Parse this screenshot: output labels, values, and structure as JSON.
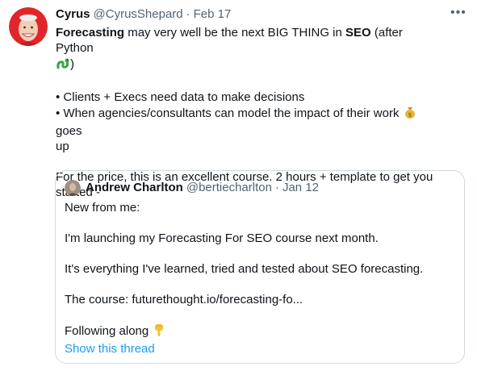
{
  "tweet": {
    "author_name": "Cyrus",
    "author_handle": "@CyrusShepard",
    "separator": "·",
    "date": "Feb 17",
    "more_label": "•••",
    "line1_bold1": "Forecasting",
    "line1_text1": " may very well be the next BIG THING in ",
    "line1_bold2": "SEO",
    "line1_text2": " (after Python",
    "line2_text": ")",
    "bullet1": "• Clients + Execs need data to make decisions",
    "bullet2_a": "• When agencies/consultants can model the impact of their work ",
    "bullet2_b": " goes",
    "bullet2_c": "up",
    "closing1": "For the price, this is an excellent course. 2 hours + template to get you",
    "closing2": "started -",
    "emoji_snake": "snake-emoji",
    "emoji_moneybag": "money-bag-emoji"
  },
  "quoted": {
    "author_name": "Andrew Charlton",
    "author_handle": "@bertiecharlton",
    "separator": "·",
    "date": "Jan 12",
    "line1": "New from me:",
    "line2": "I'm launching my Forecasting For  SEO course next month.",
    "line3": "It's everything I've learned, tried and tested about SEO forecasting.",
    "line4": "The course: futurethought.io/forecasting-fo...",
    "line5": "Following along ",
    "emoji_point": "pointing-down-emoji",
    "show_thread": "Show this thread"
  },
  "colors": {
    "link": "#1d9bf0",
    "muted": "#536471",
    "border": "#cfd9de",
    "avatar_bg": "#e0262a"
  }
}
